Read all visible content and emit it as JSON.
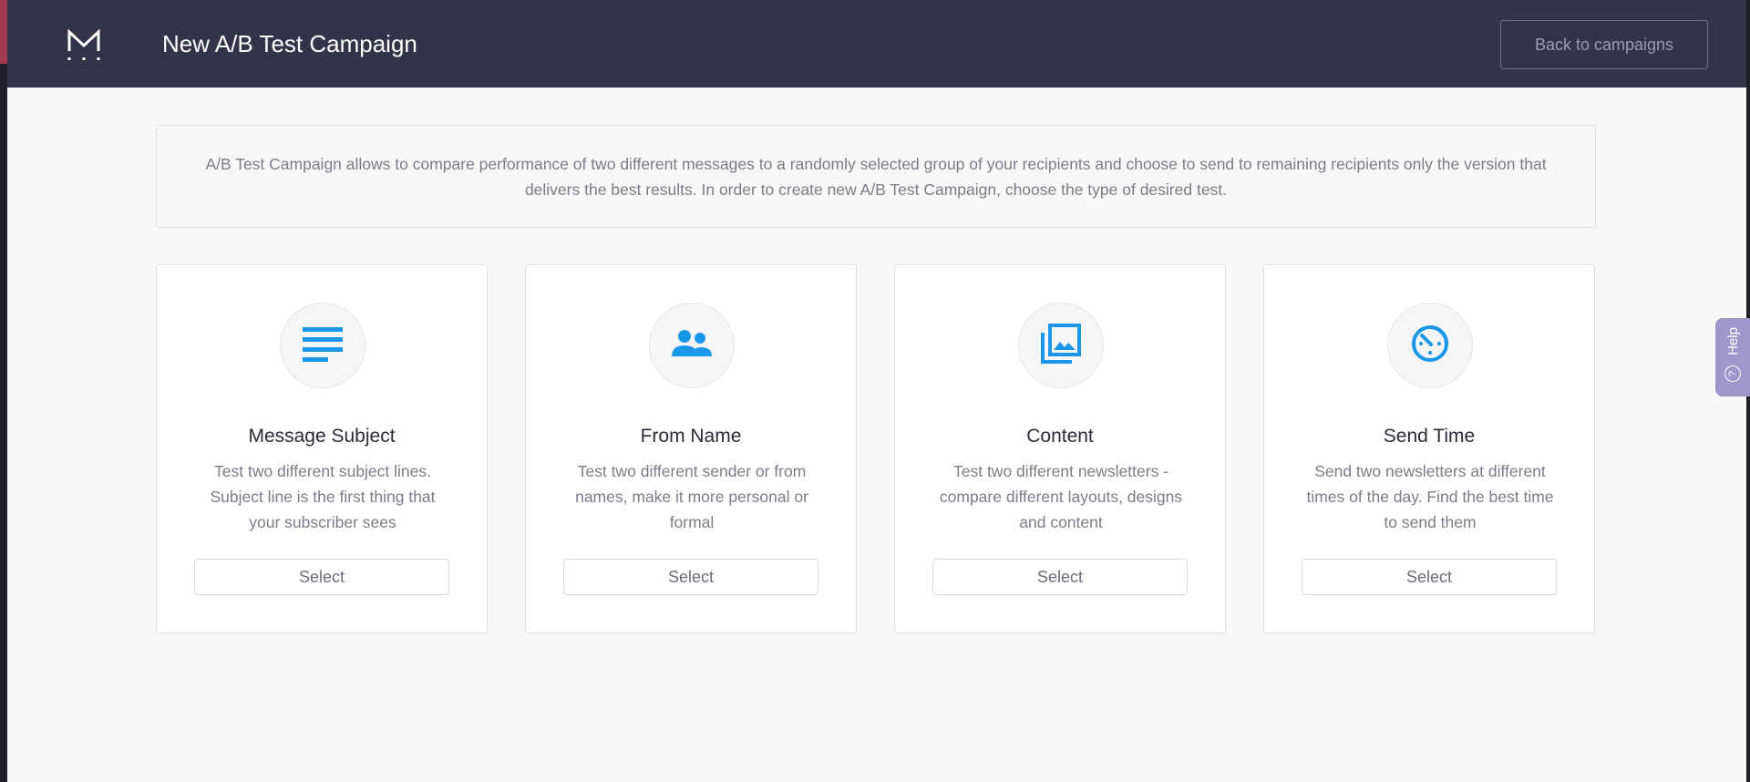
{
  "header": {
    "title": "New A/B Test Campaign",
    "back_label": "Back to campaigns",
    "logo_icon": "m-logo-icon"
  },
  "intro": {
    "text": "A/B Test Campaign allows to compare performance of two different messages to a randomly selected group of your recipients and choose to send to remaining recipients only the version that delivers the best results. In order to create new A/B Test Campaign, choose the type of desired test."
  },
  "cards": [
    {
      "icon": "subject-lines-icon",
      "title": "Message Subject",
      "description": "Test two different subject lines. Subject line is the first thing that your subscriber sees",
      "select_label": "Select"
    },
    {
      "icon": "people-icon",
      "title": "From Name",
      "description": "Test two different sender or from names, make it more personal or formal",
      "select_label": "Select"
    },
    {
      "icon": "image-gallery-icon",
      "title": "Content",
      "description": "Test two different newsletters - compare different layouts, designs and content",
      "select_label": "Select"
    },
    {
      "icon": "timer-icon",
      "title": "Send Time",
      "description": "Send two newsletters at different times of the day. Find the best time to send them",
      "select_label": "Select"
    }
  ],
  "help": {
    "label": "Help",
    "icon_glyph": "?"
  },
  "colors": {
    "header_bg": "#33334a",
    "accent_blue": "#1a97e8",
    "help_tab": "#9f97cc"
  }
}
